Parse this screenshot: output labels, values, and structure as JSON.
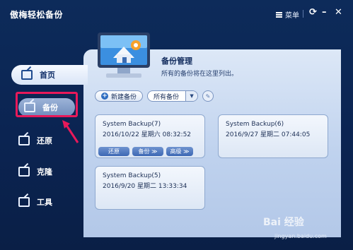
{
  "titlebar": {
    "app_title": "傲梅轻松备份",
    "menu_label": "菜单",
    "refresh_icon": "refresh-icon",
    "minimize_icon": "minimize-icon",
    "close_icon": "close-icon"
  },
  "sidebar": {
    "items": [
      {
        "label": "首页",
        "icon": "home-icon"
      },
      {
        "label": "备份",
        "icon": "backup-icon"
      },
      {
        "label": "还原",
        "icon": "restore-icon"
      },
      {
        "label": "克隆",
        "icon": "clone-icon"
      },
      {
        "label": "工具",
        "icon": "tools-icon"
      }
    ]
  },
  "main": {
    "title": "备份管理",
    "subtitle": "所有的备份将在这里列出。",
    "new_backup_label": "新建备份",
    "filter_value": "所有备份",
    "backups": [
      {
        "name": "System Backup(7)",
        "date": "2016/10/22 星期六 08:32:52",
        "actions": [
          "还原",
          "备份",
          "高级"
        ]
      },
      {
        "name": "System Backup(6)",
        "date": "2016/9/27 星期二 07:44:05"
      },
      {
        "name": "System Backup(5)",
        "date": "2016/9/20 星期二 13:33:34"
      }
    ]
  },
  "watermark": {
    "brand": "Bai 经验",
    "url": "jingyan.baidu.com"
  },
  "colors": {
    "highlight": "#e8195a",
    "frame_bg": "#0c2a57",
    "content_bg": "#c8d8ef"
  }
}
